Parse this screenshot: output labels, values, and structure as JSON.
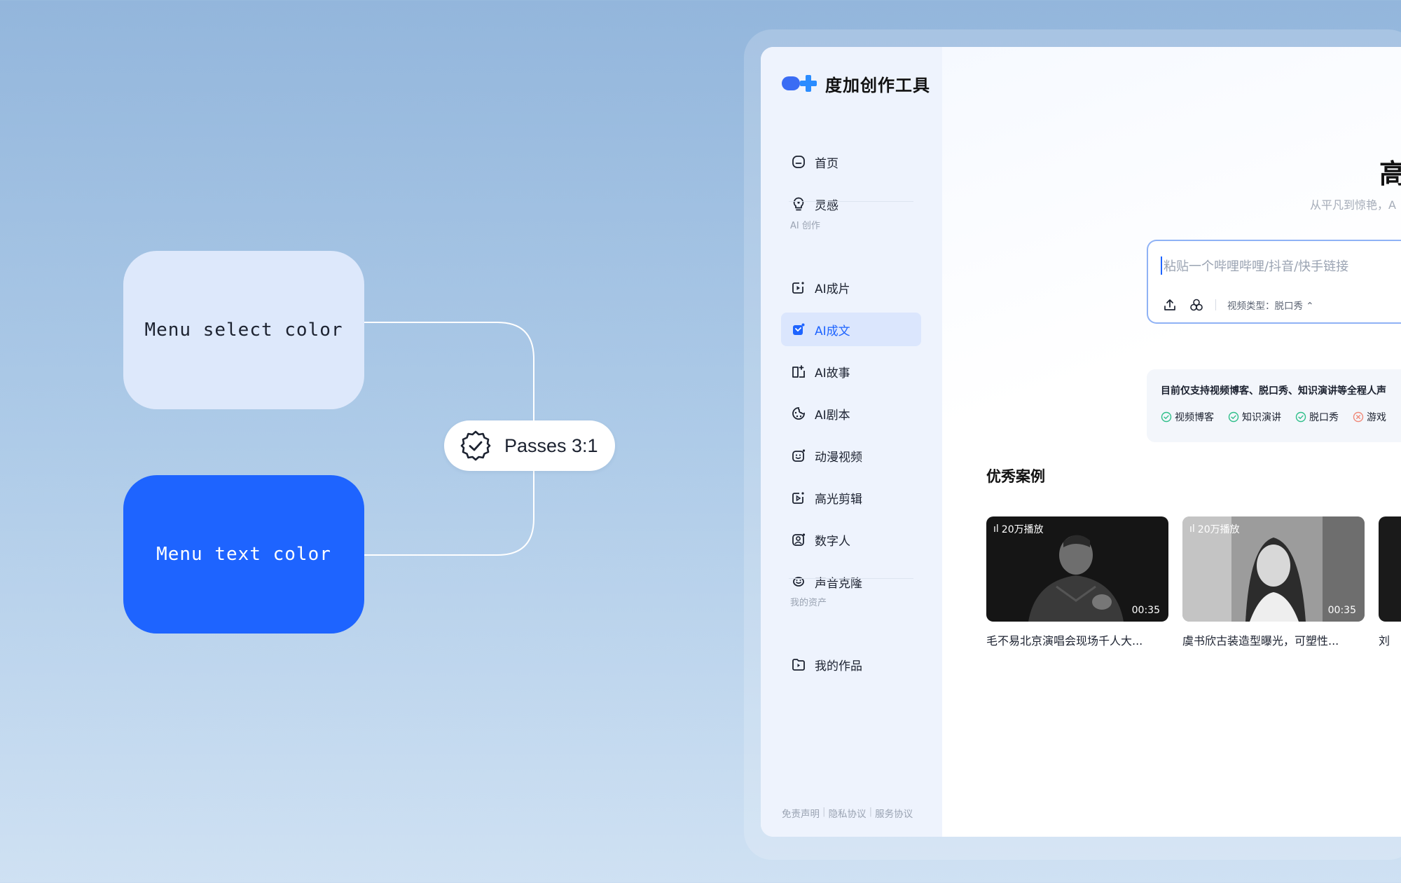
{
  "annotation": {
    "swatch_select_label": "Menu select color",
    "swatch_text_label": "Menu text color",
    "pass_label": "Passes 3:1",
    "colors": {
      "select_bg": "#dde8fb",
      "text_color": "#1e64ff"
    }
  },
  "app": {
    "brand_name": "度加创作工具",
    "nav": {
      "home": "首页",
      "inspiration": "灵感",
      "section_ai": "AI 创作",
      "ai_film": "AI成片",
      "ai_article": "AI成文",
      "ai_story": "AI故事",
      "ai_script": "AI剧本",
      "anime_video": "动漫视频",
      "highlight_edit": "高光剪辑",
      "digital_human": "数字人",
      "voice_clone": "声音克隆",
      "section_assets": "我的资产",
      "my_works": "我的作品"
    },
    "footer": {
      "disclaimer": "免责声明",
      "privacy": "隐私协议",
      "service": "服务协议"
    },
    "main": {
      "hero_title": "高",
      "hero_subtitle": "从平凡到惊艳，A",
      "input_placeholder": "粘贴一个哔哩哔哩/抖音/快手链接",
      "video_type": "视频类型：脱口秀 ⌃",
      "support_text": "目前仅支持视频博客、脱口秀、知识演讲等全程人声",
      "tags": {
        "vlog": "视频博客",
        "talk": "知识演讲",
        "standup": "脱口秀",
        "game": "游戏"
      },
      "section_title": "优秀案例",
      "cards": [
        {
          "plays": "20万播放",
          "duration": "00:35",
          "title": "毛不易北京演唱会现场千人大..."
        },
        {
          "plays": "20万播放",
          "duration": "00:35",
          "title": "虞书欣古装造型曝光，可塑性..."
        },
        {
          "plays": "",
          "duration": "",
          "title": "刘"
        }
      ]
    },
    "icons": {
      "home": "home-icon",
      "inspiration": "bulb-icon",
      "upload": "upload-icon",
      "blend": "blend-icon",
      "check": "check-circle-icon",
      "cross": "cross-circle-icon"
    }
  }
}
